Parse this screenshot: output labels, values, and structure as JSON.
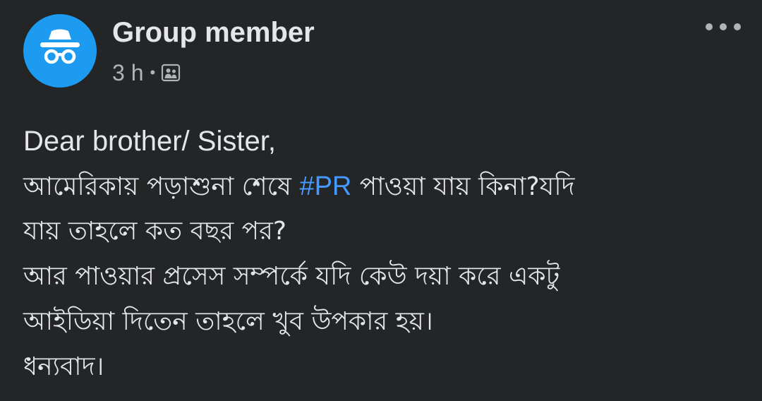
{
  "post": {
    "author": "Group member",
    "time": "3 h",
    "separator": "•",
    "avatar_icon": "incognito-icon",
    "audience_icon": "group-icon",
    "more_icon": "more-options-icon",
    "colors": {
      "background": "#242526",
      "text": "#e4e6eb",
      "secondary": "#b0b3b8",
      "hashtag": "#4599ff",
      "avatar": "#1d9bf0"
    },
    "body": {
      "line1": "Dear brother/ Sister,",
      "line2_before": "আমেরিকায় পড়াশুনা শেষে ",
      "hashtag": "#PR",
      "line2_after": " পাওয়া যায় কিনা?যদি",
      "line3": "যায় তাহলে কত বছর পর?",
      "line4": " আর পাওয়ার প্রসেস সম্পর্কে যদি কেউ দয়া করে একটু",
      "line5": "আইডিয়া দিতেন তাহলে খুব উপকার হয়।",
      "line6": "ধন্যবাদ।"
    }
  }
}
